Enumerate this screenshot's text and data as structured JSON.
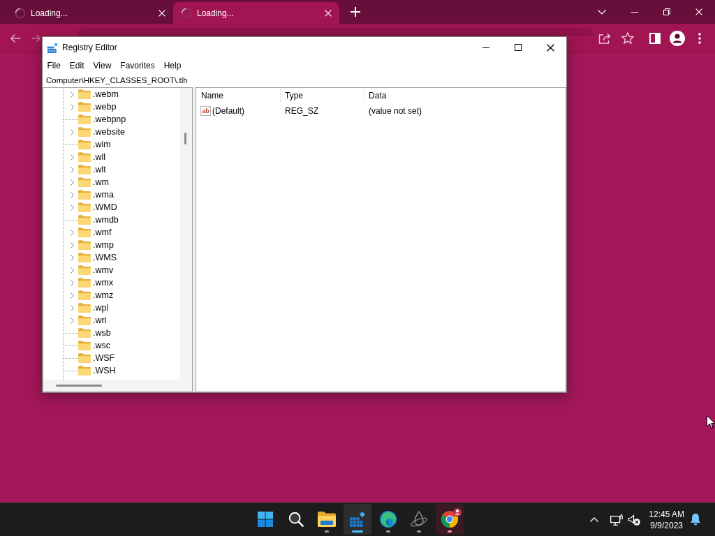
{
  "browser": {
    "tabs": [
      {
        "title": "Loading...",
        "selected": false
      },
      {
        "title": "Loading...",
        "selected": true
      }
    ]
  },
  "registry_editor": {
    "title": "Registry Editor",
    "menu": [
      "File",
      "Edit",
      "View",
      "Favorites",
      "Help"
    ],
    "address": "Computer\\HKEY_CLASSES_ROOT\\.tlh",
    "tree": [
      {
        "label": ".webm",
        "expandable": true
      },
      {
        "label": ".webp",
        "expandable": true
      },
      {
        "label": ".webpnp",
        "expandable": false
      },
      {
        "label": ".website",
        "expandable": true
      },
      {
        "label": ".wim",
        "expandable": false
      },
      {
        "label": ".wll",
        "expandable": true
      },
      {
        "label": ".wlt",
        "expandable": true
      },
      {
        "label": ".wm",
        "expandable": true
      },
      {
        "label": ".wma",
        "expandable": true
      },
      {
        "label": ".WMD",
        "expandable": true
      },
      {
        "label": ".wmdb",
        "expandable": false
      },
      {
        "label": ".wmf",
        "expandable": true
      },
      {
        "label": ".wmp",
        "expandable": true
      },
      {
        "label": ".WMS",
        "expandable": true
      },
      {
        "label": ".wmv",
        "expandable": true
      },
      {
        "label": ".wmx",
        "expandable": true
      },
      {
        "label": ".wmz",
        "expandable": true
      },
      {
        "label": ".wpl",
        "expandable": true
      },
      {
        "label": ".wri",
        "expandable": true
      },
      {
        "label": ".wsb",
        "expandable": false
      },
      {
        "label": ".wsc",
        "expandable": false
      },
      {
        "label": ".WSF",
        "expandable": false
      },
      {
        "label": ".WSH",
        "expandable": false
      }
    ],
    "columns": [
      "Name",
      "Type",
      "Data"
    ],
    "values": [
      {
        "icon": "ab",
        "name": "(Default)",
        "type": "REG_SZ",
        "data": "(value not set)"
      }
    ]
  },
  "taskbar": {
    "apps": [
      {
        "kind": "start",
        "running": false,
        "selected": false,
        "flashing": false
      },
      {
        "kind": "search",
        "running": false,
        "selected": false,
        "flashing": false
      },
      {
        "kind": "file-explorer",
        "running": true,
        "selected": false,
        "flashing": false
      },
      {
        "kind": "registry-editor",
        "running": true,
        "selected": true,
        "flashing": false
      },
      {
        "kind": "edge",
        "running": true,
        "selected": false,
        "flashing": false
      },
      {
        "kind": "drop-app",
        "running": true,
        "selected": false,
        "flashing": false
      },
      {
        "kind": "chrome",
        "running": true,
        "selected": false,
        "flashing": true
      }
    ],
    "time": "12:45 AM",
    "date": "9/9/2023"
  }
}
